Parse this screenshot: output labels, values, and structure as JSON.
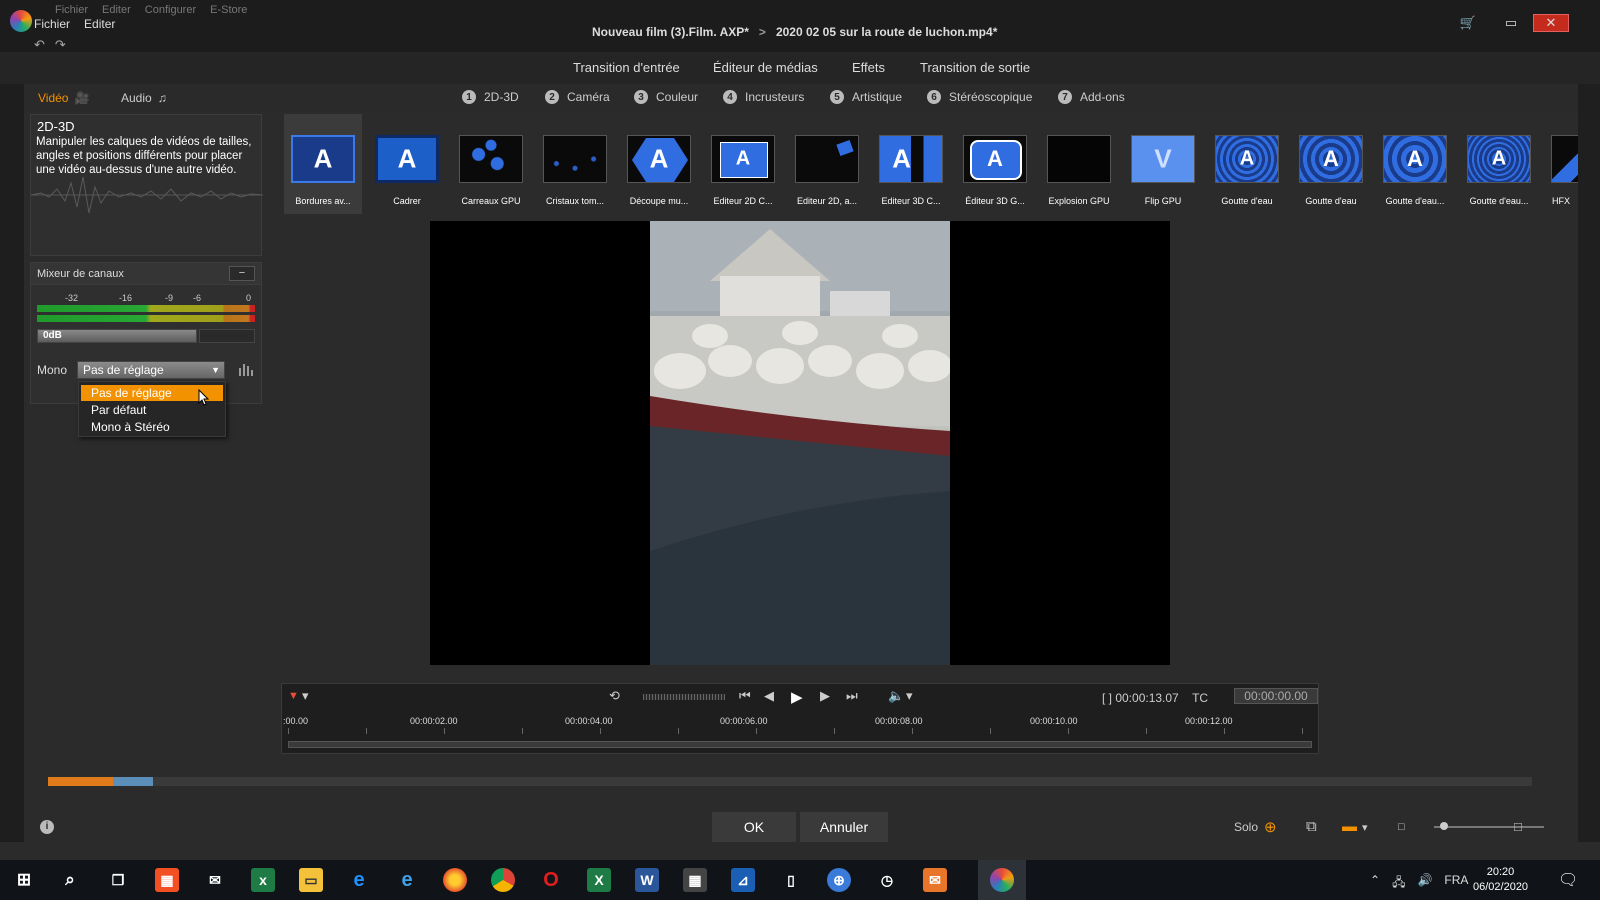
{
  "titlebar": {
    "menu": [
      "Fichier",
      "Editer"
    ],
    "ghost_menu": [
      "Fichier",
      "Editer",
      "Configurer",
      "E-Store"
    ],
    "project": "Nouveau film (3).Film. AXP*",
    "separator": ">",
    "clip": "2020 02 05 sur la route de luchon.mp4*"
  },
  "main_tabs": [
    "Transition d'entrée",
    "Éditeur de médias",
    "Effets",
    "Transition de sortie"
  ],
  "media_tabs": {
    "video": "Vidéo",
    "audio": "Audio"
  },
  "categories": [
    {
      "num": "1",
      "label": "2D-3D"
    },
    {
      "num": "2",
      "label": "Caméra"
    },
    {
      "num": "3",
      "label": "Couleur"
    },
    {
      "num": "4",
      "label": "Incrusteurs"
    },
    {
      "num": "5",
      "label": "Artistique"
    },
    {
      "num": "6",
      "label": "Stéréoscopique"
    },
    {
      "num": "7",
      "label": "Add-ons"
    }
  ],
  "info_panel": {
    "title": "2D-3D",
    "description": "Manipuler les calques de vidéos de tailles, angles et positions différents pour placer une vidéo au-dessus d'une autre vidéo."
  },
  "effects": [
    "Bordures av...",
    "Cadrer",
    "Carreaux GPU",
    "Cristaux tom...",
    "Découpe mu...",
    "Editeur 2D C...",
    "Editeur 2D, a...",
    "Editeur 3D C...",
    "Éditeur 3D G...",
    "Explosion GPU",
    "Flip GPU",
    "Goutte d'eau",
    "Goutte d'eau",
    "Goutte d'eau...",
    "Goutte d'eau...",
    "HFX"
  ],
  "mixer": {
    "title": "Mixeur de canaux",
    "collapse": "−",
    "ticks": [
      "-32",
      "-16",
      "-9",
      "-6",
      "0"
    ],
    "gain": "0dB",
    "mono_label": "Mono",
    "selected": "Pas de réglage",
    "options": [
      "Pas de réglage",
      "Par défaut",
      "Mono à Stéréo"
    ]
  },
  "timeline": {
    "duration": "[ ] 00:00:13.07",
    "tc_label": "TC",
    "tc_value": "00:00:00.00",
    "ruler": [
      ":00.00",
      "00:00:02.00",
      "00:00:04.00",
      "00:00:06.00",
      "00:00:08.00",
      "00:00:10.00",
      "00:00:12.00"
    ]
  },
  "footer": {
    "ok": "OK",
    "cancel": "Annuler",
    "solo": "Solo"
  },
  "taskbar": {
    "lang": "FRA",
    "time": "20:20",
    "date": "06/02/2020"
  },
  "colors": {
    "accent": "#f39200",
    "close": "#c42b1c"
  }
}
